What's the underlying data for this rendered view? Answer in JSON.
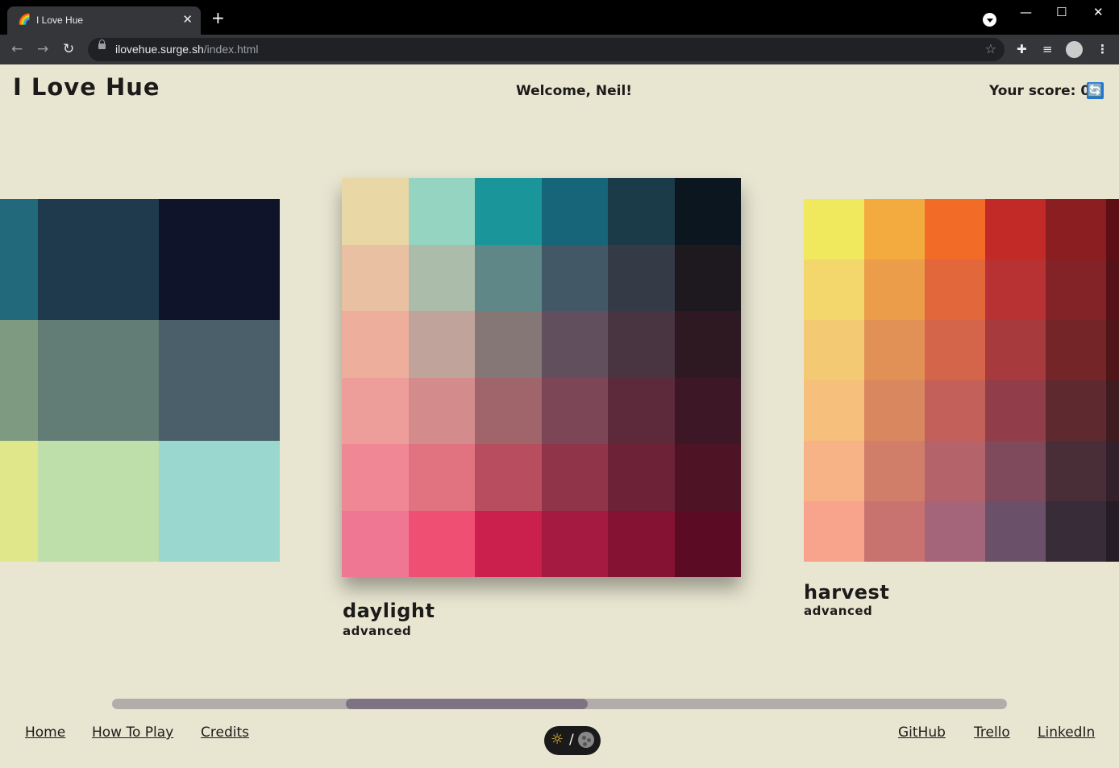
{
  "browser": {
    "tab_title": "I Love Hue",
    "tab_icon": "rainbow-icon",
    "tab_close": "✕",
    "new_tab": "+",
    "url_host": "ilovehue.surge.sh",
    "url_path": "/index.html",
    "back": "←",
    "forward": "→",
    "reload": "↻",
    "star": "☆",
    "minimize": "—",
    "maximize": "☐",
    "close": "✕",
    "extensions": "✚",
    "media": "≡",
    "menu": "⋮"
  },
  "header": {
    "logo": "I Love Hue",
    "welcome": "Welcome, Neil!",
    "score_label": "Your score: 0",
    "refresh_icon": "🔄"
  },
  "palettes": {
    "left": {
      "colors": [
        [
          "#21697b",
          "#1f3a4d",
          "#10142a"
        ],
        [
          "#7e9a80",
          "#627c76",
          "#4a5f69"
        ],
        [
          "#dfe78a",
          "#bedeaa",
          "#99d7cf"
        ]
      ]
    },
    "center": {
      "name": "daylight",
      "level": "advanced",
      "colors": [
        [
          "#ead7a6",
          "#95d4c0",
          "#1a9599",
          "#166579",
          "#1b3b48",
          "#0b161f"
        ],
        [
          "#eac0a2",
          "#abbcaa",
          "#5f8788",
          "#435867",
          "#353a47",
          "#1d191f"
        ],
        [
          "#eeae9c",
          "#c0a39a",
          "#847776",
          "#624f5e",
          "#493442",
          "#2e1822"
        ],
        [
          "#ed9d9a",
          "#d48b8b",
          "#a0656b",
          "#7c4657",
          "#5c2a3a",
          "#3e1726"
        ],
        [
          "#ef8795",
          "#e1727f",
          "#b74d5e",
          "#8f3449",
          "#6d2237",
          "#4e1426"
        ],
        [
          "#f07794",
          "#ef4f72",
          "#cb204e",
          "#a51a40",
          "#851232",
          "#5c0b24"
        ]
      ]
    },
    "right": {
      "name": "harvest",
      "level": "advanced",
      "colors": [
        [
          "#f0e95e",
          "#f3aa3e",
          "#f26c27",
          "#c12a27",
          "#8a1e20",
          "#5c1016"
        ],
        [
          "#f4d76c",
          "#eb9d4a",
          "#e2673a",
          "#b93233",
          "#832227",
          "#551319"
        ],
        [
          "#f4c973",
          "#e29156",
          "#d4644a",
          "#a73a3c",
          "#732527",
          "#4e1619"
        ],
        [
          "#f6bf7b",
          "#d8875f",
          "#c4605a",
          "#923e4a",
          "#5e2a30",
          "#3f1c20"
        ],
        [
          "#f7b286",
          "#d07e69",
          "#b4636a",
          "#7f4b5c",
          "#4a2e37",
          "#32202a"
        ],
        [
          "#f8a38c",
          "#c87370",
          "#a4647a",
          "#6b506a",
          "#382c38",
          "#261c26"
        ]
      ]
    }
  },
  "footer": {
    "links_left": [
      "Home",
      "How To Play",
      "Credits"
    ],
    "links_right": [
      "GitHub",
      "Trello",
      "LinkedIn"
    ],
    "toggle_sun": "☼",
    "toggle_slash": "/"
  }
}
